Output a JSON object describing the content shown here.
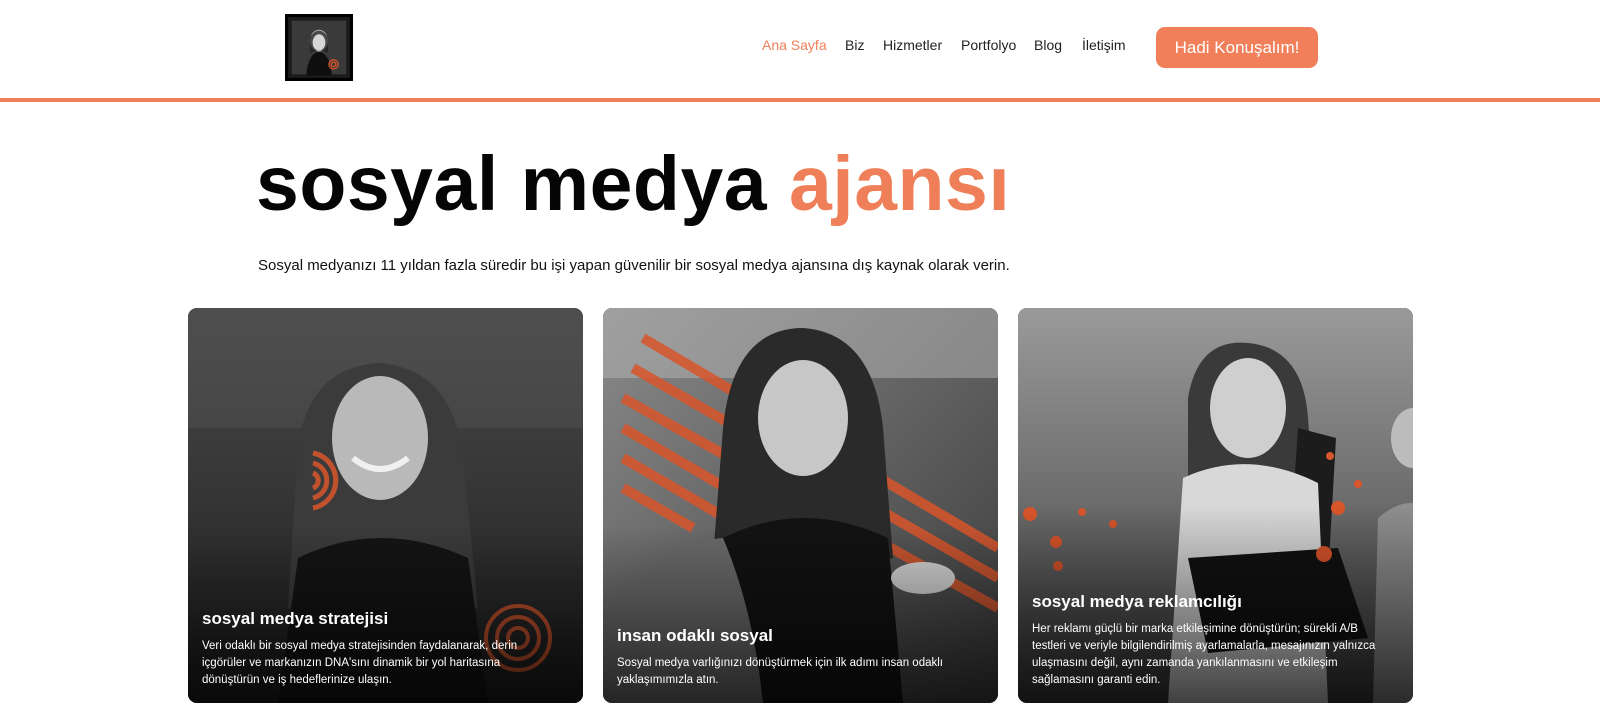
{
  "nav": {
    "items": [
      {
        "label": "Ana Sayfa",
        "active": true
      },
      {
        "label": "Biz",
        "active": false
      },
      {
        "label": "Hizmetler",
        "active": false
      },
      {
        "label": "Portfolyo",
        "active": false
      },
      {
        "label": "Blog",
        "active": false
      },
      {
        "label": "İletişim",
        "active": false
      }
    ],
    "cta_label": "Hadi Konuşalım!"
  },
  "hero": {
    "title_main": "sosyal medya ",
    "title_accent": "ajansı",
    "subtitle": "Sosyal medyanızı 11 yıldan fazla süredir bu işi yapan güvenilir bir sosyal medya ajansına dış kaynak olarak verin."
  },
  "cards": [
    {
      "title": "sosyal medya stratejisi",
      "desc_lines": [
        "Veri odaklı bir sosyal medya stratejisinden faydalanarak, derin",
        "içgörüler ve markanızın DNA'sını dinamik bir yol haritasına",
        "dönüştürün ve iş hedeflerinize ulaşın."
      ]
    },
    {
      "title": "insan odaklı sosyal",
      "desc_lines": [
        "Sosyal medya varlığınızı dönüştürmek için ilk adımı insan odaklı",
        "yaklaşımımızla atın."
      ]
    },
    {
      "title": "sosyal medya reklamcılığı",
      "desc_lines": [
        "Her reklamı güçlü bir marka etkileşimine dönüştürün; sürekli A/B",
        "testleri ve veriyle bilgilendirilmiş ayarlamalarla, mesajınızın yalnızca",
        "ulaşmasını değil, aynı zamanda yankılanmasını ve etkileşim",
        "sağlamasını garanti edin."
      ]
    }
  ],
  "colors": {
    "accent": "#ee7f58",
    "cta_bg": "#f07f5a",
    "text": "#111111"
  },
  "icons": {
    "logo": "portrait-photo-logo"
  }
}
